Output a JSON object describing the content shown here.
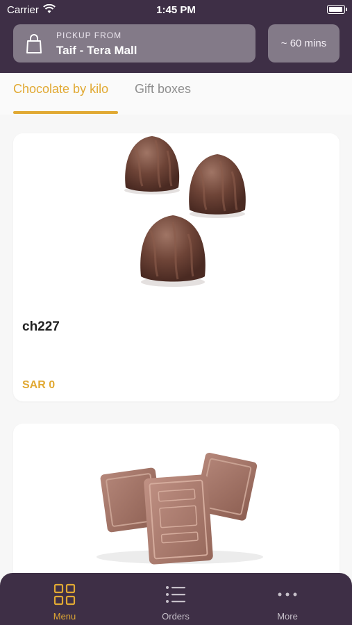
{
  "status_bar": {
    "carrier": "Carrier",
    "time": "1:45 PM",
    "battery_level": 0.95
  },
  "header": {
    "pickup_label": "PICKUP FROM",
    "store_name": "Taif - Tera Mall",
    "eta": "~ 60 mins",
    "pickup_icon": "shopping-bag-icon"
  },
  "tabs": [
    {
      "label": "Chocolate by kilo",
      "active": true
    },
    {
      "label": "Gift boxes",
      "active": false
    }
  ],
  "products": [
    {
      "name": "ch227",
      "price": "SAR 0",
      "image": "chocolate-truffles-image"
    },
    {
      "name": "",
      "price": "",
      "image": "chocolate-gold-bars-image"
    }
  ],
  "tab_bar": [
    {
      "label": "Menu",
      "icon": "grid-icon",
      "active": true
    },
    {
      "label": "Orders",
      "icon": "list-icon",
      "active": false
    },
    {
      "label": "More",
      "icon": "more-icon",
      "active": false
    }
  ],
  "colors": {
    "brand_dark": "#3e2f46",
    "accent": "#e1a933",
    "header_button": "#837a88"
  }
}
